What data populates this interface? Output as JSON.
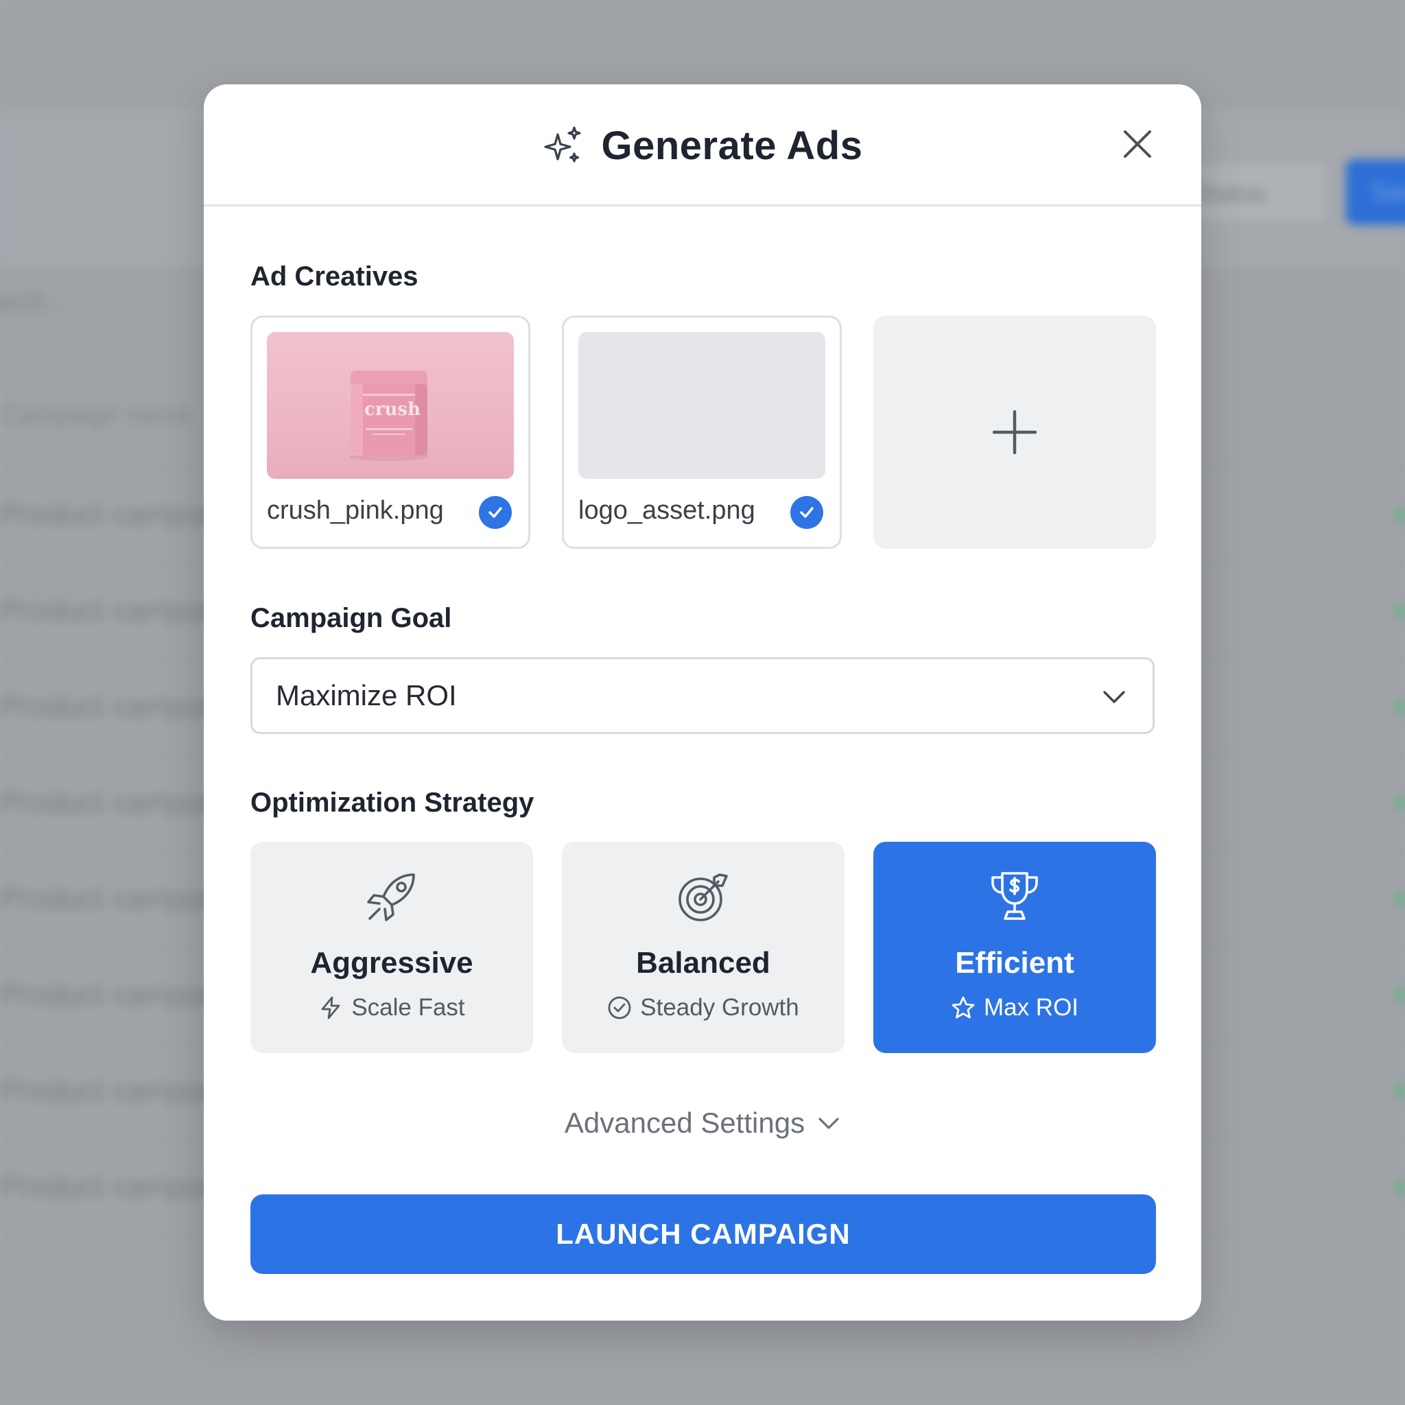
{
  "background": {
    "filter_label": "Status",
    "primary_button_label": "Save",
    "search_placeholder": "Search...",
    "table_header": "Campaign name",
    "rows": [
      "Product campaign",
      "Product campaign",
      "Product campaign",
      "Product campaign",
      "Product campaign",
      "Product campaign",
      "Product campaign",
      "Product campaign"
    ]
  },
  "modal": {
    "title": "Generate Ads",
    "title_icon": "sparkles-icon",
    "close_icon": "close-icon",
    "creatives": {
      "label": "Ad Creatives",
      "items": [
        {
          "file_name": "crush_pink.png",
          "thumb_text": "crush",
          "selected": true
        },
        {
          "file_name": "logo_asset.png",
          "selected": true
        }
      ],
      "add_icon": "plus-icon"
    },
    "goal": {
      "label": "Campaign Goal",
      "value": "Maximize ROI"
    },
    "strategy": {
      "label": "Optimization Strategy",
      "options": [
        {
          "name": "Aggressive",
          "sub": "Scale Fast",
          "icon": "rocket-icon",
          "sub_icon": "lightning-icon",
          "selected": false
        },
        {
          "name": "Balanced",
          "sub": "Steady Growth",
          "icon": "target-icon",
          "sub_icon": "check-circle-icon",
          "selected": false
        },
        {
          "name": "Efficient",
          "sub": "Max ROI",
          "icon": "trophy-icon",
          "sub_icon": "star-icon",
          "selected": true
        }
      ]
    },
    "advanced_label": "Advanced Settings",
    "launch_label": "LAUNCH CAMPAIGN"
  },
  "colors": {
    "accent": "#2C74E6",
    "card_bg": "#EFF0F2",
    "text_primary": "#1F2430",
    "overlay": "#A3A6AB"
  }
}
